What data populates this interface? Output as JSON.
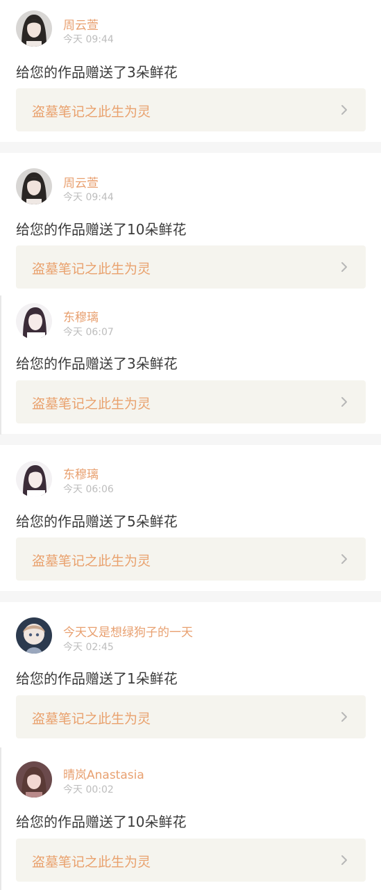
{
  "notifications": [
    {
      "name": "周云萱",
      "time": "今天 09:44",
      "gift_text": "给您的作品赠送了3朵鲜花",
      "work_title": "盗墓笔记之此生为灵",
      "avatar": "avatar-girl-dark-hair"
    },
    {
      "name": "周云萱",
      "time": "今天 09:44",
      "gift_text": "给您的作品赠送了10朵鲜花",
      "work_title": "盗墓笔记之此生为灵",
      "avatar": "avatar-girl-dark-hair"
    },
    {
      "name": "东穆璃",
      "time": "今天 06:07",
      "gift_text": "给您的作品赠送了3朵鲜花",
      "work_title": "盗墓笔记之此生为灵",
      "avatar": "avatar-girl-white"
    },
    {
      "name": "东穆璃",
      "time": "今天 06:06",
      "gift_text": "给您的作品赠送了5朵鲜花",
      "work_title": "盗墓笔记之此生为灵",
      "avatar": "avatar-girl-white"
    },
    {
      "name": "今天又是想绿狗子的一天",
      "time": "今天 02:45",
      "gift_text": "给您的作品赠送了1朵鲜花",
      "work_title": "盗墓笔记之此生为灵",
      "avatar": "avatar-anime-doll"
    },
    {
      "name": "晴岚Anastasia",
      "time": "今天 00:02",
      "gift_text": "给您的作品赠送了10朵鲜花",
      "work_title": "盗墓笔记之此生为灵",
      "avatar": "avatar-girl-pink"
    }
  ],
  "colors": {
    "name": "#e8a070",
    "time": "#bdbdbd",
    "card_bg": "#f5f4ee",
    "work_title": "#e9a16d",
    "separator": "#f6f6f6"
  },
  "icons": {
    "chevron": "chevron-right-icon"
  }
}
